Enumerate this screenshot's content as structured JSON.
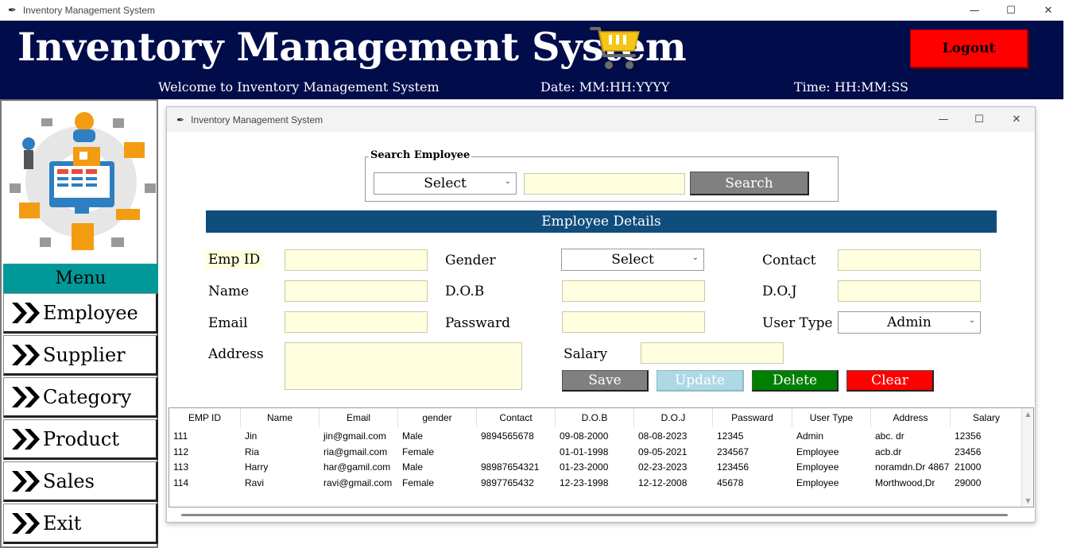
{
  "window": {
    "title": "Inventory Management System",
    "controls": {
      "minimize": "—",
      "maximize": "☐",
      "close": "✕"
    }
  },
  "header": {
    "title": "Inventory Management System",
    "logout_label": "Logout",
    "welcome": "Welcome to Inventory Management System",
    "date": "Date: MM:HH:YYYY",
    "time": "Time: HH:MM:SS",
    "cart_icon": "shopping-cart-icon"
  },
  "sidebar": {
    "menu_title": "Menu",
    "items": [
      {
        "label": "Employee"
      },
      {
        "label": "Supplier"
      },
      {
        "label": "Category"
      },
      {
        "label": "Product"
      },
      {
        "label": "Sales"
      },
      {
        "label": "Exit"
      }
    ]
  },
  "employee_window": {
    "title": "Inventory Management System",
    "search": {
      "legend": "Search Employee",
      "select_value": "Select",
      "text_value": "",
      "button_label": "Search"
    },
    "details_title": "Employee Details",
    "fields": {
      "emp_id": {
        "label": "Emp ID",
        "value": ""
      },
      "gender": {
        "label": "Gender",
        "value": "Select"
      },
      "contact": {
        "label": "Contact",
        "value": ""
      },
      "name": {
        "label": "Name",
        "value": ""
      },
      "dob": {
        "label": "D.O.B",
        "value": ""
      },
      "doj": {
        "label": "D.O.J",
        "value": ""
      },
      "email": {
        "label": "Email",
        "value": ""
      },
      "password": {
        "label": "Passward",
        "value": ""
      },
      "user_type": {
        "label": "User Type",
        "value": "Admin"
      },
      "address": {
        "label": "Address",
        "value": ""
      },
      "salary": {
        "label": "Salary",
        "value": ""
      }
    },
    "buttons": {
      "save": "Save",
      "update": "Update",
      "delete": "Delete",
      "clear": "Clear"
    },
    "table": {
      "columns": [
        "EMP ID",
        "Name",
        "Email",
        "gender",
        "Contact",
        "D.O.B",
        "D.O.J",
        "Passward",
        "User Type",
        "Address",
        "Salary"
      ],
      "rows": [
        [
          "111",
          "Jin",
          "jin@gmail.com",
          "Male",
          "9894565678",
          "09-08-2000",
          "08-08-2023",
          "12345",
          "Admin",
          "abc. dr",
          "12356"
        ],
        [
          "112",
          "Ria",
          "ria@gmail.com",
          "Female",
          "",
          "01-01-1998",
          "09-05-2021",
          "234567",
          "Employee",
          "acb.dr",
          "23456"
        ],
        [
          "113",
          "Harry",
          "har@gamil.com",
          "Male",
          "98987654321",
          "01-23-2000",
          "02-23-2023",
          "123456",
          "Employee",
          "noramdn.Dr 4867",
          "21000"
        ],
        [
          "114",
          "Ravi",
          "ravi@gmail.com",
          "Female",
          "9897765432",
          "12-23-1998",
          "12-12-2008",
          "45678",
          "Employee",
          "Morthwood,Dr",
          "29000"
        ]
      ]
    }
  },
  "colors": {
    "header_bg": "#010c4a",
    "logout": "#ff0000",
    "menu_title": "#009999",
    "details_bar": "#0f4d7d",
    "entry_bg": "#ffffe0",
    "save": "#808080",
    "update": "#add8e6",
    "delete": "#008000",
    "clear": "#ff0000"
  }
}
